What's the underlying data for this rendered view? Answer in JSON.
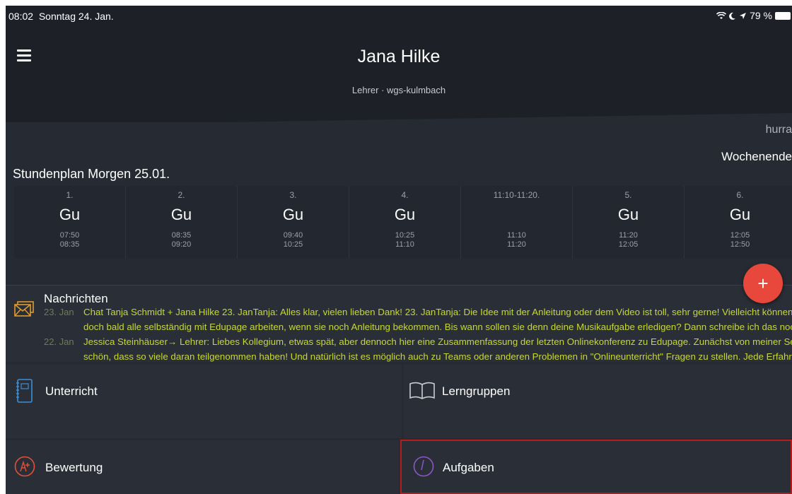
{
  "status": {
    "time": "08:02",
    "date": "Sonntag 24. Jan.",
    "battery": "79 %"
  },
  "header": {
    "title": "Jana Hilke",
    "subtitle": "Lehrer · wgs-kulmbach"
  },
  "greeting": {
    "line1": "hurra",
    "line2": "Wochenende"
  },
  "schedule": {
    "title": "Stundenplan Morgen 25.01.",
    "slots": [
      {
        "num": "1.",
        "subject": "Gu",
        "start": "07:50",
        "end": "08:35"
      },
      {
        "num": "2.",
        "subject": "Gu",
        "start": "08:35",
        "end": "09:20"
      },
      {
        "num": "3.",
        "subject": "Gu",
        "start": "09:40",
        "end": "10:25"
      },
      {
        "num": "4.",
        "subject": "Gu",
        "start": "10:25",
        "end": "11:10"
      },
      {
        "num": "11:10-11:20.",
        "subject": "",
        "start": "11:10",
        "end": "11:20"
      },
      {
        "num": "5.",
        "subject": "Gu",
        "start": "11:20",
        "end": "12:05"
      },
      {
        "num": "6.",
        "subject": "Gu",
        "start": "12:05",
        "end": "12:50"
      }
    ]
  },
  "fab": {
    "label": "+"
  },
  "messages": {
    "title": "Nachrichten",
    "items": [
      {
        "date": "23. Jan",
        "line1": "Chat Tanja Schmidt + Jana Hilke 23. JanTanja: Alles klar, vielen lieben Dank! 23. JanTanja: Die Idee mit der Anleitung oder dem Video ist toll, sehr gerne! Vielleicht können ja",
        "line2": "doch bald alle selbständig mit Edupage arbeiten, wenn sie noch Anleitung bekommen. Bis wann sollen sie denn deine Musikaufgabe erledigen? Dann schreibe ich das noch."
      },
      {
        "date": "22. Jan",
        "line1": "Jessica Steinhäuser→ Lehrer: Liebes Kollegium, etwas spät, aber dennoch hier eine Zusammenfassung der letzten Onlinekonferenz zu Edupage. Zunächst von meiner Seite:",
        "line2": "schön, dass so viele daran teilgenommen haben! Und natürlich ist es möglich auch zu Teams oder anderen Problemen in \"Onlineunterricht\" Fragen zu stellen. Jede Erfahrun."
      }
    ]
  },
  "tiles": {
    "unterricht": "Unterricht",
    "lerngruppen": "Lerngruppen",
    "bewertung": "Bewertung",
    "aufgaben": "Aufgaben"
  },
  "colors": {
    "accent": "#e8483b",
    "messageText": "#c6d82e",
    "selection": "#b51d1d",
    "background": "#262b33",
    "header": "#1d2127"
  }
}
